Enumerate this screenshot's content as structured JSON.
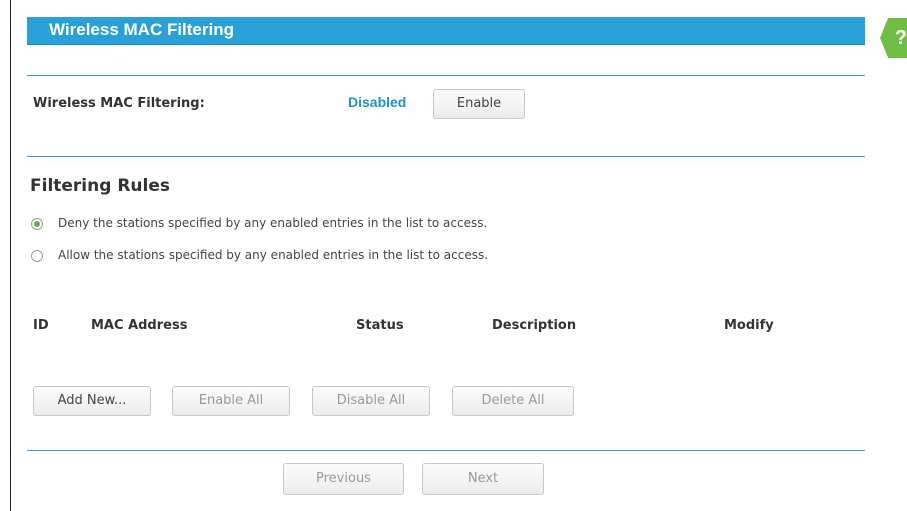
{
  "page": {
    "title": "Wireless MAC Filtering",
    "help_label": "?"
  },
  "mac_filtering": {
    "label": "Wireless MAC Filtering:",
    "status": "Disabled",
    "enable_button": "Enable"
  },
  "filtering_rules": {
    "heading": "Filtering Rules",
    "options": [
      {
        "label": "Deny the stations specified by any enabled entries in the list to access.",
        "checked": true
      },
      {
        "label": "Allow the stations specified by any enabled entries in the list to access.",
        "checked": false
      }
    ]
  },
  "table": {
    "columns": [
      "ID",
      "MAC Address",
      "Status",
      "Description",
      "Modify"
    ]
  },
  "actions": {
    "add_new": "Add New...",
    "enable_all": "Enable All",
    "disable_all": "Disable All",
    "delete_all": "Delete All"
  },
  "pagination": {
    "previous": "Previous",
    "next": "Next"
  },
  "colors": {
    "accent": "#29a1d8",
    "status": "#1f92c9",
    "help": "#6fbd44",
    "radio_selected": "#5bb540"
  }
}
